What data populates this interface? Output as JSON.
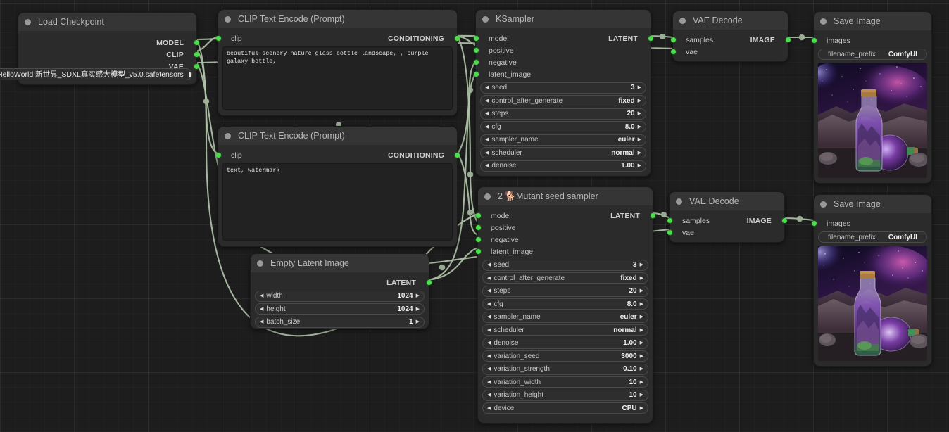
{
  "app": {
    "name": "ComfyUI",
    "canvas": "node-graph"
  },
  "nodes": {
    "load_checkpoint": {
      "title": "Load Checkpoint",
      "outputs": [
        "MODEL",
        "CLIP",
        "VAE"
      ],
      "widget": {
        "label": "",
        "value": "HelloWorld 新世界_SDXL真实感大模型_v5.0.safetensors"
      }
    },
    "clip_positive": {
      "title": "CLIP Text Encode (Prompt)",
      "input": "clip",
      "output": "CONDITIONING",
      "text": "beautiful scenery nature glass bottle landscape, , purple galaxy bottle,"
    },
    "clip_negative": {
      "title": "CLIP Text Encode (Prompt)",
      "input": "clip",
      "output": "CONDITIONING",
      "text": "text, watermark"
    },
    "empty_latent": {
      "title": "Empty Latent Image",
      "output": "LATENT",
      "widgets": [
        {
          "name": "width",
          "value": "1024"
        },
        {
          "name": "height",
          "value": "1024"
        },
        {
          "name": "batch_size",
          "value": "1"
        }
      ]
    },
    "ksampler": {
      "title": "KSampler",
      "inputs": [
        "model",
        "positive",
        "negative",
        "latent_image"
      ],
      "output": "LATENT",
      "widgets": [
        {
          "name": "seed",
          "value": "3"
        },
        {
          "name": "control_after_generate",
          "value": "fixed"
        },
        {
          "name": "steps",
          "value": "20"
        },
        {
          "name": "cfg",
          "value": "8.0"
        },
        {
          "name": "sampler_name",
          "value": "euler"
        },
        {
          "name": "scheduler",
          "value": "normal"
        },
        {
          "name": "denoise",
          "value": "1.00"
        }
      ]
    },
    "mutant_sampler": {
      "title": "2 🐕Mutant seed sampler",
      "inputs": [
        "model",
        "positive",
        "negative",
        "latent_image"
      ],
      "output": "LATENT",
      "widgets": [
        {
          "name": "seed",
          "value": "3"
        },
        {
          "name": "control_after_generate",
          "value": "fixed"
        },
        {
          "name": "steps",
          "value": "20"
        },
        {
          "name": "cfg",
          "value": "8.0"
        },
        {
          "name": "sampler_name",
          "value": "euler"
        },
        {
          "name": "scheduler",
          "value": "normal"
        },
        {
          "name": "denoise",
          "value": "1.00"
        },
        {
          "name": "variation_seed",
          "value": "3000"
        },
        {
          "name": "variation_strength",
          "value": "0.10"
        },
        {
          "name": "variation_width",
          "value": "10"
        },
        {
          "name": "variation_height",
          "value": "10"
        },
        {
          "name": "device",
          "value": "CPU"
        }
      ]
    },
    "vae_decode_top": {
      "title": "VAE Decode",
      "inputs": [
        "samples",
        "vae"
      ],
      "output": "IMAGE"
    },
    "vae_decode_bottom": {
      "title": "VAE Decode",
      "inputs": [
        "samples",
        "vae"
      ],
      "output": "IMAGE"
    },
    "save_image_top": {
      "title": "Save Image",
      "input": "images",
      "widget": {
        "name": "filename_prefix",
        "value": "ComfyUI"
      },
      "preview_alt": "purple galaxy bottle landscape with mountains and starry nebula sky"
    },
    "save_image_bottom": {
      "title": "Save Image",
      "input": "images",
      "widget": {
        "name": "filename_prefix",
        "value": "ComfyUI"
      },
      "preview_alt": "purple galaxy bottle landscape variation with mountains and nebula sky"
    }
  },
  "colors": {
    "link": "#b0c3a8",
    "slot_dot": "#49e04a",
    "node_body": "#2b2b2b",
    "node_title": "#353535",
    "canvas_bg": "#1d1d1d"
  },
  "icons": {
    "title_dot": "collapse-dot-icon",
    "left_arrow": "◀",
    "right_arrow": "▶"
  }
}
